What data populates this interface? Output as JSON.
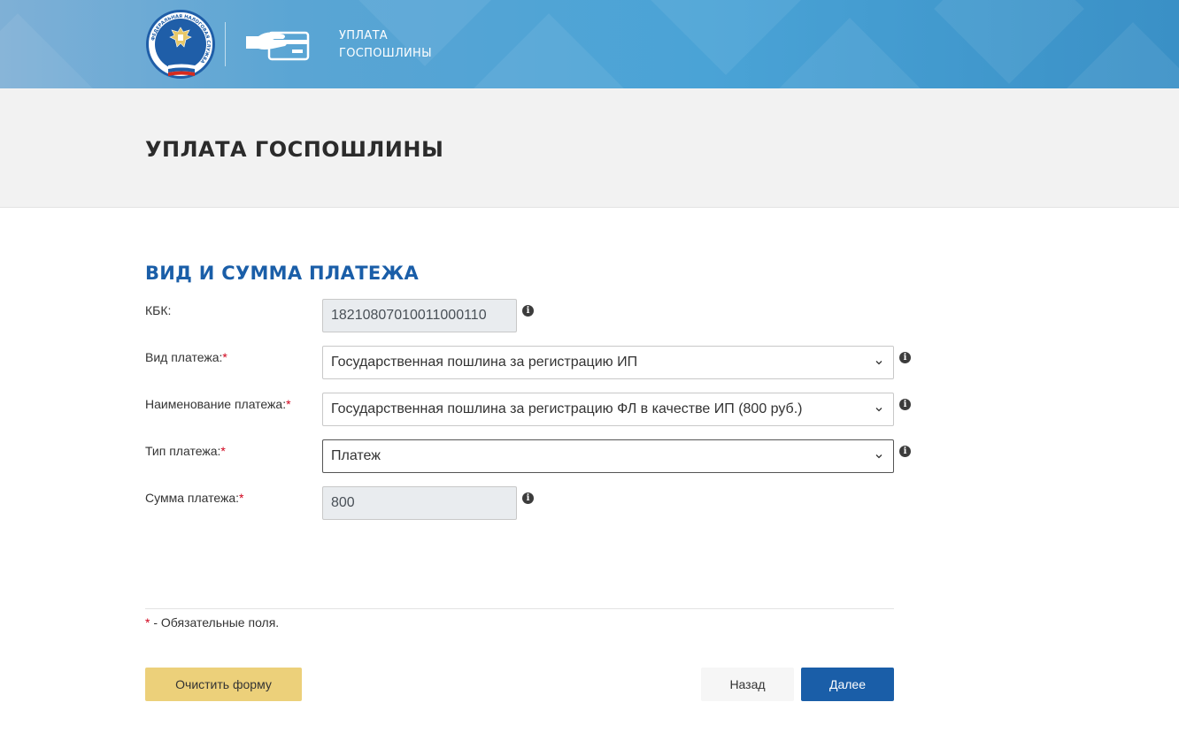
{
  "header": {
    "title_line1": "УПЛАТА",
    "title_line2": "ГОСПОШЛИНЫ",
    "logo_ring_text": "ФЕДЕРАЛЬНАЯ НАЛОГОВАЯ СЛУЖБА",
    "icons": {
      "logo": "fns-emblem-icon",
      "service": "card-payment-icon"
    }
  },
  "page_title": "УПЛАТА ГОСПОШЛИНЫ",
  "section": {
    "title": "ВИД И СУММА ПЛАТЕЖА",
    "fields": [
      {
        "label": "КБК:",
        "required": false,
        "value": "18210807010011000110"
      },
      {
        "label": "Вид платежа:",
        "required": true,
        "value": "Государственная пошлина за регистрацию ИП"
      },
      {
        "label": "Наименование платежа:",
        "required": true,
        "value": "Государственная пошлина за регистрацию ФЛ в качестве ИП (800 руб.)"
      },
      {
        "label": "Тип платежа:",
        "required": true,
        "value": "Платеж"
      },
      {
        "label": "Сумма платежа:",
        "required": true,
        "value": "800"
      }
    ],
    "required_mark": "*",
    "info_glyph": "i"
  },
  "footer": {
    "required_note": " - Обязательные поля.",
    "buttons": {
      "clear": "Очистить форму",
      "back": "Назад",
      "next": "Далее"
    }
  },
  "colors": {
    "accent": "#1a5ea8",
    "clear_button": "#ecd07a",
    "required": "#d0021b"
  }
}
